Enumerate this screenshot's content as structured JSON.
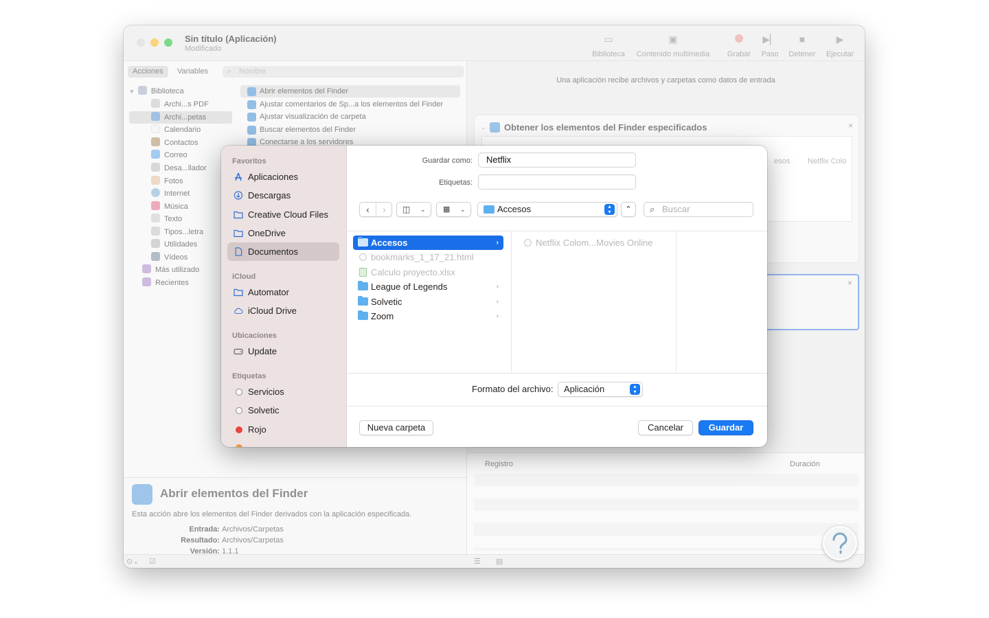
{
  "window": {
    "title": "Sin título (Aplicación)",
    "subtitle": "Modificado",
    "toolbar": [
      {
        "label": "Biblioteca",
        "icon": "library-icon"
      },
      {
        "label": "Contenido multimedia",
        "icon": "media-icon"
      },
      {
        "label": "Grabar",
        "icon": "record-icon"
      },
      {
        "label": "Paso",
        "icon": "step-icon"
      },
      {
        "label": "Detener",
        "icon": "stop-icon"
      },
      {
        "label": "Ejecutar",
        "icon": "run-icon"
      }
    ]
  },
  "left": {
    "tabs": [
      "Acciones",
      "Variables"
    ],
    "search_placeholder": "Nombre",
    "library": [
      "Biblioteca",
      "Archi...s PDF",
      "Archi...petas",
      "Calendario",
      "Contactos",
      "Correo",
      "Desa...llador",
      "Fotos",
      "Internet",
      "Música",
      "Texto",
      "Tipos...letra",
      "Utilidades",
      "Vídeos",
      "Más utilizado",
      "Recientes"
    ],
    "actions": [
      "Abrir elementos del Finder",
      "Ajustar comentarios de Sp...a los elementos del Finder",
      "Ajustar visualización de carpeta",
      "Buscar elementos del Finder",
      "Conectarse a los servidores"
    ]
  },
  "description": {
    "title": "Abrir elementos del Finder",
    "text": "Esta acción abre los elementos del Finder derivados con la aplicación especificada.",
    "input_label": "Entrada:",
    "input_value": "Archivos/Carpetas",
    "result_label": "Resultado:",
    "result_value": "Archivos/Carpetas",
    "version_label": "Versión:",
    "version_value": "1.1.1"
  },
  "right": {
    "info": "Una aplicación recibe archivos y carpetas como datos de entrada",
    "card_title": "Obtener los elementos del Finder especificados",
    "path_fragment_1": "esos",
    "path_fragment_2": "Netflix Colo",
    "log_header": "Registro",
    "duration_header": "Duración"
  },
  "dialog": {
    "save_as_label": "Guardar como:",
    "save_as_value": "Netflix",
    "tags_label": "Etiquetas:",
    "location": "Accesos",
    "search_placeholder": "Buscar",
    "sidebar": {
      "favorites_title": "Favoritos",
      "favorites": [
        "Aplicaciones",
        "Descargas",
        "Creative Cloud Files",
        "OneDrive",
        "Documentos"
      ],
      "icloud_title": "iCloud",
      "icloud": [
        "Automator",
        "iCloud Drive"
      ],
      "locations_title": "Ubicaciones",
      "locations": [
        "Update"
      ],
      "tags_title": "Etiquetas",
      "tags": [
        "Servicios",
        "Solvetic",
        "Rojo"
      ],
      "tag_colors": [
        "#ffffff",
        "#ffffff",
        "#e8453c"
      ]
    },
    "column1": [
      {
        "name": "Accesos",
        "kind": "folder",
        "selected": true
      },
      {
        "name": "bookmarks_1_17_21.html",
        "kind": "file",
        "disabled": true
      },
      {
        "name": "Calculo proyecto.xlsx",
        "kind": "xlsx",
        "disabled": true
      },
      {
        "name": "League of Legends",
        "kind": "folder"
      },
      {
        "name": "Solvetic",
        "kind": "folder"
      },
      {
        "name": "Zoom",
        "kind": "folder"
      }
    ],
    "column2": [
      {
        "name": "Netflix Colom...Movies Online",
        "kind": "file",
        "disabled": true
      }
    ],
    "format_label": "Formato del archivo:",
    "format_value": "Aplicación",
    "new_folder": "Nueva carpeta",
    "cancel": "Cancelar",
    "save": "Guardar"
  },
  "colors": {
    "accent": "#1a7af2",
    "selection": "#1a6fe8",
    "sidebar": "#ece2e2"
  }
}
